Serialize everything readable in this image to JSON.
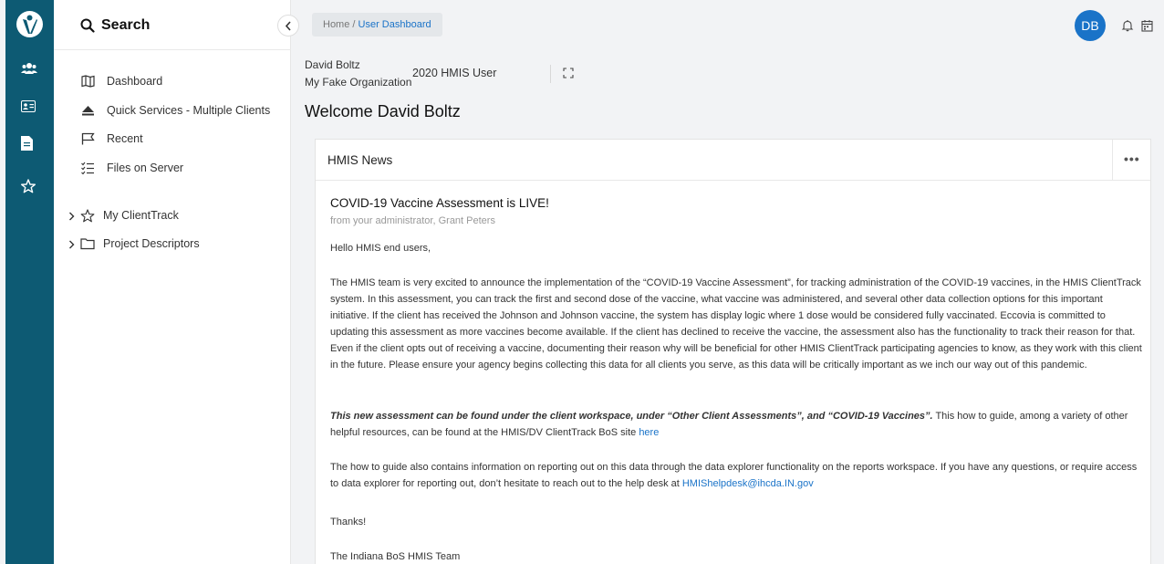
{
  "sidebar": {
    "search_title": "Search",
    "nav": [
      {
        "label": "Dashboard"
      },
      {
        "label": "Quick Services - Multiple Clients"
      },
      {
        "label": "Recent"
      },
      {
        "label": "Files on Server"
      }
    ],
    "tree": [
      {
        "label": "My ClientTrack"
      },
      {
        "label": "Project Descriptors"
      }
    ]
  },
  "breadcrumb": {
    "home": "Home",
    "separator": " / ",
    "current": "User Dashboard"
  },
  "user": {
    "initials": "DB",
    "name": "David Boltz",
    "org": "My Fake Organization",
    "role": "2020 HMIS User"
  },
  "welcome": "Welcome David Boltz",
  "news": {
    "card_title": "HMIS News",
    "more": "•••",
    "title": "COVID-19 Vaccine Assessment is LIVE!",
    "from": "from your administrator, Grant Peters",
    "greeting": "Hello HMIS end users,",
    "body1": "The HMIS team is very excited to announce the implementation of the “COVID-19 Vaccine Assessment”, for tracking administration of the COVID-19 vaccines, in the HMIS ClientTrack system. In this assessment, you can track the first and second dose of the vaccine, what vaccine was administered, and several other data collection options for this important initiative. If the client has received the Johnson and Johnson vaccine, the system has display logic where 1 dose would be considered fully vaccinated. Eccovia is committed to updating this assessment as more vaccines become available. If the client has declined to receive the vaccine, the assessment also has the functionality to track their reason for that. Even if the client opts out of receiving a vaccine, documenting their reason why will be beneficial for other HMIS ClientTrack participating agencies to know, as they work with this client in the future. Please ensure your agency begins collecting this data for all clients you serve, as this data will be critically important as we inch our way out of this pandemic.",
    "body2_em": "This new assessment can be found under the client workspace, under “Other Client Assessments”, and “COVID-19 Vaccines”.",
    "body2_rest": " This how to guide, among a variety of other helpful resources, can be found at the HMIS/DV ClientTrack BoS site ",
    "body2_link": "here",
    "body3": "The how to guide also contains information on reporting out on this data through the data explorer functionality on the reports workspace. If you have any questions, or require access to data explorer for reporting out, don’t hesitate to reach out to the help desk at ",
    "body3_link": "HMIShelpdesk@ihcda.IN.gov",
    "thanks": "Thanks!",
    "signoff": "The Indiana BoS HMIS Team"
  },
  "colors": {
    "rail": "#0d5a73",
    "accent": "#1a73c8"
  },
  "icons": [
    "logo-icon",
    "users-icon",
    "id-card-icon",
    "file-icon",
    "star-icon",
    "search-icon",
    "map-icon",
    "eject-icon",
    "flag-icon",
    "list-check-icon",
    "folder-icon",
    "bell-icon",
    "calendar-icon",
    "expand-icon"
  ]
}
